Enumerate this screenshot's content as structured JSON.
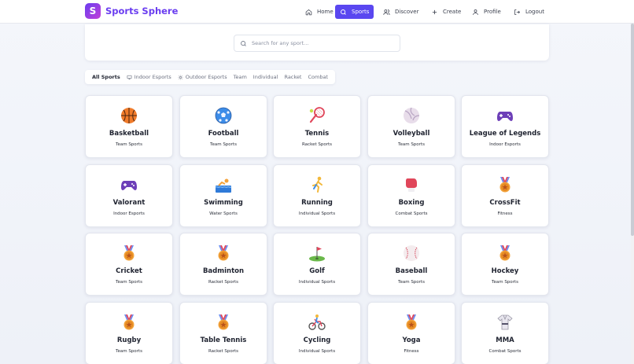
{
  "brand": {
    "logo_letter": "S",
    "name": "Sports Sphere"
  },
  "nav": [
    {
      "label": "Home",
      "icon": "home-icon",
      "active": false
    },
    {
      "label": "Sports",
      "icon": "search-icon",
      "active": true
    },
    {
      "label": "Discover",
      "icon": "users-icon",
      "active": false
    },
    {
      "label": "Create",
      "icon": "plus-icon",
      "active": false
    },
    {
      "label": "Profile",
      "icon": "user-icon",
      "active": false
    },
    {
      "label": "Logout",
      "icon": "logout-icon",
      "active": false
    }
  ],
  "search": {
    "placeholder": "Search for any sport...",
    "value": ""
  },
  "filters": [
    {
      "label": "All Sports",
      "icon": "",
      "active": true
    },
    {
      "label": "Indoor Esports",
      "icon": "monitor-icon",
      "active": false
    },
    {
      "label": "Outdoor Esports",
      "icon": "sun-icon",
      "active": false
    },
    {
      "label": "Team",
      "icon": "",
      "active": false
    },
    {
      "label": "Individual",
      "icon": "",
      "active": false
    },
    {
      "label": "Racket",
      "icon": "",
      "active": false
    },
    {
      "label": "Combat",
      "icon": "",
      "active": false
    }
  ],
  "sports": [
    {
      "name": "Basketball",
      "category": "Team Sports",
      "icon": "basketball-icon"
    },
    {
      "name": "Football",
      "category": "Team Sports",
      "icon": "soccer-ball-icon"
    },
    {
      "name": "Tennis",
      "category": "Racket Sports",
      "icon": "tennis-racket-icon"
    },
    {
      "name": "Volleyball",
      "category": "Team Sports",
      "icon": "volleyball-icon"
    },
    {
      "name": "League of Legends",
      "category": "Indoor Esports",
      "icon": "gamepad-icon"
    },
    {
      "name": "Valorant",
      "category": "Indoor Esports",
      "icon": "gamepad-icon"
    },
    {
      "name": "Swimming",
      "category": "Water Sports",
      "icon": "swimmer-icon"
    },
    {
      "name": "Running",
      "category": "Individual Sports",
      "icon": "runner-icon"
    },
    {
      "name": "Boxing",
      "category": "Combat Sports",
      "icon": "boxing-glove-icon"
    },
    {
      "name": "CrossFit",
      "category": "Fitness",
      "icon": "medal-icon"
    },
    {
      "name": "Cricket",
      "category": "Team Sports",
      "icon": "medal-icon"
    },
    {
      "name": "Badminton",
      "category": "Racket Sports",
      "icon": "medal-icon"
    },
    {
      "name": "Golf",
      "category": "Individual Sports",
      "icon": "golf-flag-icon"
    },
    {
      "name": "Baseball",
      "category": "Team Sports",
      "icon": "baseball-icon"
    },
    {
      "name": "Hockey",
      "category": "Team Sports",
      "icon": "medal-icon"
    },
    {
      "name": "Rugby",
      "category": "Team Sports",
      "icon": "medal-icon"
    },
    {
      "name": "Table Tennis",
      "category": "Racket Sports",
      "icon": "medal-icon"
    },
    {
      "name": "Cycling",
      "category": "Individual Sports",
      "icon": "cyclist-icon"
    },
    {
      "name": "Yoga",
      "category": "Fitness",
      "icon": "medal-icon"
    },
    {
      "name": "MMA",
      "category": "Combat Sports",
      "icon": "martial-arts-uniform-icon"
    }
  ],
  "colors": {
    "accent": "#5a47f0",
    "brand_gradient_start": "#6a3df0",
    "brand_gradient_end": "#c23fd8"
  }
}
